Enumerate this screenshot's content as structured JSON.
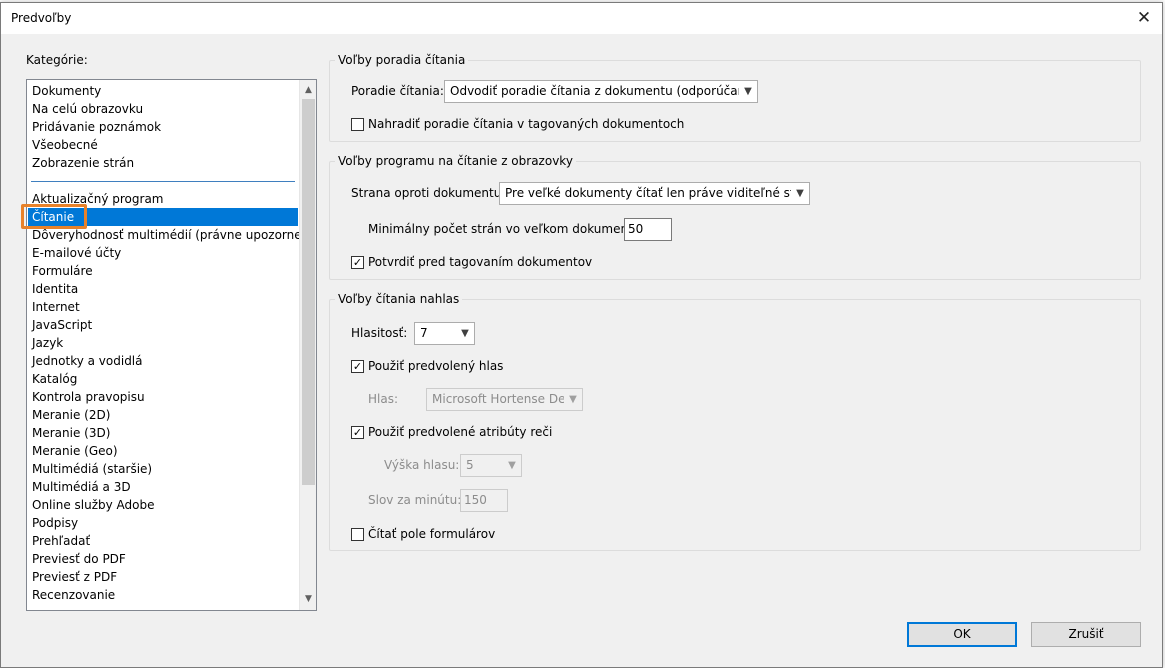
{
  "dialog": {
    "title": "Predvoľby",
    "close_glyph": "✕"
  },
  "categories": {
    "label": "Kategórie:",
    "items": [
      "Dokumenty",
      "Na celú obrazovku",
      "Pridávanie poznámok",
      "Všeobecné",
      "Zobrazenie strán",
      "Aktualizačný program",
      "Čítanie",
      "Dôveryhodnosť multimédií (právne upozornenie)",
      "E-mailové účty",
      "Formuláre",
      "Identita",
      "Internet",
      "JavaScript",
      "Jazyk",
      "Jednotky a vodidlá",
      "Katalóg",
      "Kontrola pravopisu",
      "Meranie (2D)",
      "Meranie (3D)",
      "Meranie (Geo)",
      "Multimédiá (staršie)",
      "Multimédiá a 3D",
      "Online služby Adobe",
      "Podpisy",
      "Prehľadať",
      "Previesť do PDF",
      "Previesť z PDF",
      "Recenzovanie"
    ],
    "selected": "Čítanie",
    "scroll_up_glyph": "▲",
    "scroll_down_glyph": "▼"
  },
  "reading_order": {
    "title": "Voľby poradia čítania",
    "order_label": "Poradie čítania:",
    "order_value": "Odvodiť poradie čítania z dokumentu (odporúčame)",
    "override_label": "Nahradiť poradie čítania v tagovaných dokumentoch",
    "override_checked": false
  },
  "screen_reader": {
    "title": "Voľby programu na čítanie z obrazovky",
    "page_vs_doc_label": "Strana oproti dokumentu:",
    "page_vs_doc_value": "Pre veľké dokumenty čítať len práve viditeľné strany",
    "min_pages_label": "Minimálny počet strán vo veľkom dokumente:",
    "min_pages_value": "50",
    "confirm_label": "Potvrdiť pred tagovaním dokumentov",
    "confirm_checked": true
  },
  "read_aloud": {
    "title": "Voľby čítania nahlas",
    "volume_label": "Hlasitosť:",
    "volume_value": "7",
    "default_voice_label": "Použiť predvolený hlas",
    "default_voice_checked": true,
    "voice_label": "Hlas:",
    "voice_value": "Microsoft Hortense Deskt",
    "default_attrs_label": "Použiť predvolené atribúty reči",
    "default_attrs_checked": true,
    "pitch_label": "Výška hlasu:",
    "pitch_value": "5",
    "wpm_label": "Slov za minútu:",
    "wpm_value": "150",
    "read_fields_label": "Čítať pole formulárov",
    "read_fields_checked": false
  },
  "buttons": {
    "ok": "OK",
    "cancel": "Zrušiť"
  },
  "icons": {
    "combo_arrow": "chevron-down-icon",
    "check": "✓"
  },
  "colors": {
    "selection": "#0078d7",
    "highlight": "#e8822a"
  }
}
